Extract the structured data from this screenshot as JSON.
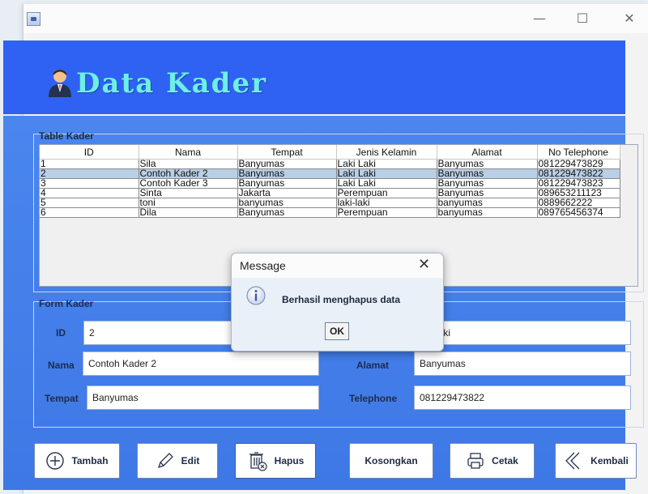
{
  "window": {
    "min_glyph": "—",
    "max_glyph": "☐",
    "close_glyph": "✕"
  },
  "app_title": "Data Kader",
  "table_group_title": "Table Kader",
  "table": {
    "columns": [
      "ID",
      "Nama",
      "Tempat",
      "Jenis Kelamin",
      "Alamat",
      "No Telephone"
    ],
    "rows": [
      [
        "1",
        "Sila",
        "Banyumas",
        "Laki Laki",
        "Banyumas",
        "081229473829"
      ],
      [
        "2",
        "Contoh Kader 2",
        "Banyumas",
        "Laki Laki",
        "Banyumas",
        "081229473822"
      ],
      [
        "3",
        "Contoh Kader 3",
        "Banyumas",
        "Laki Laki",
        "Banyumas",
        "081229473823"
      ],
      [
        "4",
        "Sinta",
        "Jakarta",
        "Perempuan",
        "Banyumas",
        "089653211123"
      ],
      [
        "5",
        "toni",
        "banyumas",
        "laki-laki",
        "banyumas",
        "0889662222"
      ],
      [
        "6",
        "Dila",
        "Banyumas",
        "Perempuan",
        "banyumas",
        "089765456374"
      ]
    ],
    "selected_row": 1
  },
  "form": {
    "group_title": "Form Kader",
    "id_label": "ID",
    "id_value": "2",
    "nama_label": "Nama",
    "nama_value": "Contoh Kader 2",
    "tempat_label": "Tempat",
    "tempat_value": "Banyumas",
    "jenis_value": "Laki",
    "alamat_label": "Alamat",
    "alamat_value": "Banyumas",
    "telephone_label": "Telephone",
    "telephone_value": "081229473822"
  },
  "buttons": {
    "tambah": "Tambah",
    "edit": "Edit",
    "hapus": "Hapus",
    "kosongkan": "Kosongkan",
    "cetak": "Cetak",
    "kembali": "Kembali"
  },
  "dialog": {
    "title": "Message",
    "close_glyph": "✕",
    "message": "Berhasil menghapus data",
    "ok_label": "OK"
  },
  "colors": {
    "header_band": "#2f62f2",
    "panel": "#4a86ee",
    "title_text": "#6ef0e6",
    "selected_row": "#b8cfe5"
  }
}
